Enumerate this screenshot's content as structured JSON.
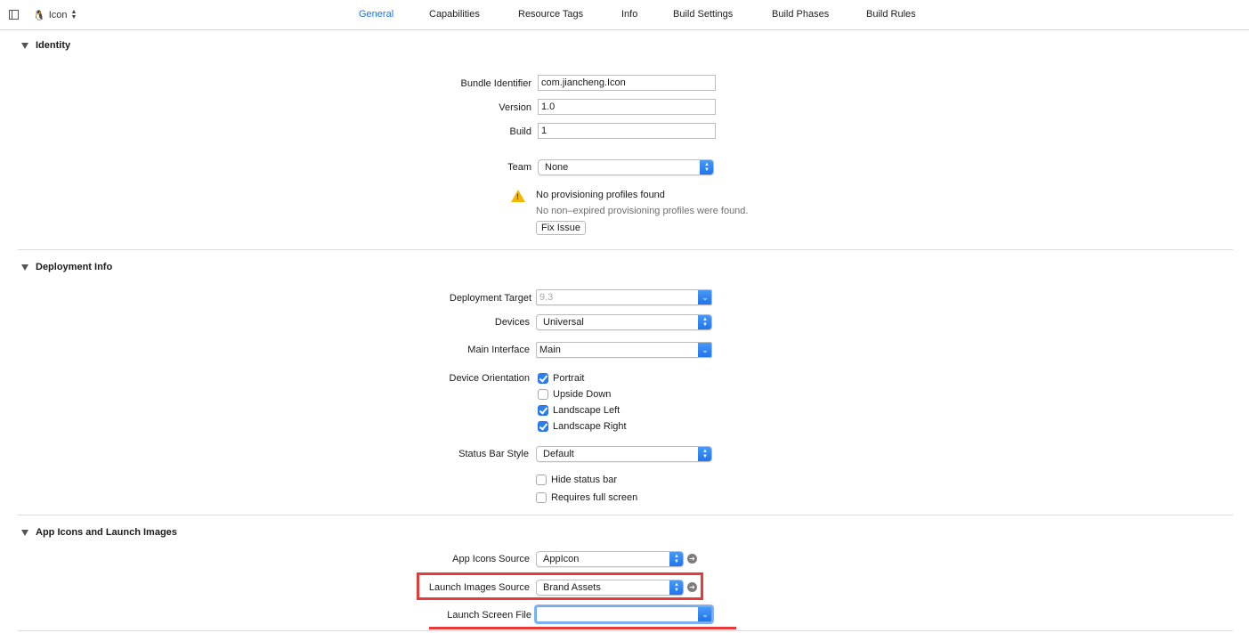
{
  "topbar": {
    "target_name": "Icon",
    "tabs": [
      "General",
      "Capabilities",
      "Resource Tags",
      "Info",
      "Build Settings",
      "Build Phases",
      "Build Rules"
    ],
    "active_tab": "General"
  },
  "identity": {
    "title": "Identity",
    "bundle_identifier_label": "Bundle Identifier",
    "bundle_identifier_value": "com.jiancheng.Icon",
    "version_label": "Version",
    "version_value": "1.0",
    "build_label": "Build",
    "build_value": "1",
    "team_label": "Team",
    "team_value": "None",
    "warning_title": "No provisioning profiles found",
    "warning_detail": "No non–expired provisioning profiles were found.",
    "fix_button": "Fix Issue"
  },
  "deployment": {
    "title": "Deployment Info",
    "target_label": "Deployment Target",
    "target_value": "9.3",
    "devices_label": "Devices",
    "devices_value": "Universal",
    "main_interface_label": "Main Interface",
    "main_interface_value": "Main",
    "orientation_label": "Device Orientation",
    "orientations": [
      {
        "label": "Portrait",
        "checked": true
      },
      {
        "label": "Upside Down",
        "checked": false
      },
      {
        "label": "Landscape Left",
        "checked": true
      },
      {
        "label": "Landscape Right",
        "checked": true
      }
    ],
    "status_bar_label": "Status Bar Style",
    "status_bar_value": "Default",
    "hide_status_bar": {
      "label": "Hide status bar",
      "checked": false
    },
    "requires_full_screen": {
      "label": "Requires full screen",
      "checked": false
    }
  },
  "app_icons": {
    "title": "App Icons and Launch Images",
    "icons_source_label": "App Icons Source",
    "icons_source_value": "AppIcon",
    "launch_images_label": "Launch Images Source",
    "launch_images_value": "Brand Assets",
    "launch_screen_label": "Launch Screen File",
    "launch_screen_value": ""
  },
  "colors": {
    "accent": "#1f73d8",
    "highlight": "#e83a3a",
    "warning": "#f2b807"
  }
}
